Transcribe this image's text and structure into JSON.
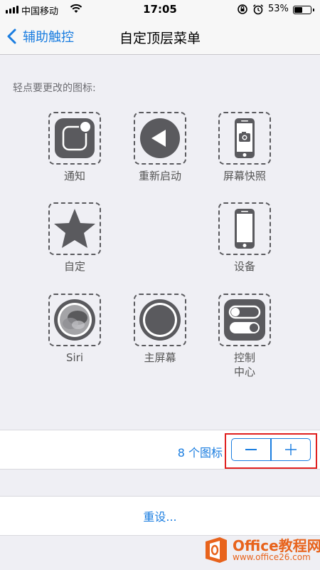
{
  "status_bar": {
    "carrier": "中国移动",
    "time": "17:05",
    "battery_percent": "53%",
    "battery_level": 0.53,
    "icons": [
      "signal-icon",
      "wifi-icon",
      "rotation-lock-icon",
      "alarm-icon",
      "battery-icon"
    ]
  },
  "nav": {
    "back_label": "辅助触控",
    "title": "自定顶层菜单"
  },
  "instruction": "轻点要更改的图标:",
  "icons": [
    {
      "label": "通知",
      "icon": "notification-icon"
    },
    {
      "label": "重新启动",
      "icon": "restart-icon"
    },
    {
      "label": "屏幕快照",
      "icon": "screenshot-icon"
    },
    {
      "label": "自定",
      "icon": "star-icon"
    },
    {
      "label": "设备",
      "icon": "device-icon"
    },
    {
      "label": "Siri",
      "icon": "siri-icon"
    },
    {
      "label": "主屏幕",
      "icon": "home-icon"
    },
    {
      "label": "控制\n中心",
      "icon": "control-center-icon"
    }
  ],
  "count": {
    "label": "8 个图标",
    "value": 8
  },
  "stepper": {
    "decrement_icon": "minus-icon",
    "increment_icon": "plus-icon"
  },
  "reset_label": "重设...",
  "watermark": {
    "title": "Office教程网",
    "url": "www.office26.com"
  },
  "colors": {
    "accent": "#1a7de0",
    "highlight": "#e0201f",
    "icon_dark": "#5a5a5e",
    "watermark": "#e8631c"
  }
}
